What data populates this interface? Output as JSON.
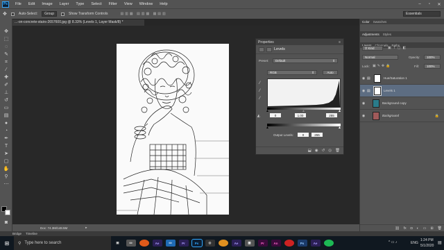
{
  "app": {
    "logo": "Ps"
  },
  "menu": [
    "File",
    "Edit",
    "Image",
    "Layer",
    "Type",
    "Select",
    "Filter",
    "View",
    "Window",
    "Help"
  ],
  "options": {
    "auto_select": "Auto-Select:",
    "group": "Group",
    "transform": "Show Transform Controls",
    "workspace": "Essentials"
  },
  "document": {
    "tab_title": "...-on-concrete-stairs-2657600.jpg @ 8.33% (Levels 1, Layer Mask/8) *",
    "status": "Doc: 74.3M/148.5M"
  },
  "properties": {
    "panel_tab": "Properties",
    "title": "Levels",
    "preset_label": "Preset:",
    "preset_value": "Default",
    "channel": "RGB",
    "auto": "Auto",
    "input": {
      "black": "0",
      "mid": "1.00",
      "white": "255"
    },
    "output_label": "Output Levels:",
    "output": {
      "black": "0",
      "white": "255"
    }
  },
  "right_panels": {
    "tabs1": [
      "Color",
      "Swatches"
    ],
    "tabs2": [
      "Adjustments",
      "Styles"
    ],
    "tabs3": [
      "Layers",
      "Channels",
      "Paths"
    ],
    "kind": "Kind",
    "blend": "Normal",
    "opacity_label": "Opacity:",
    "opacity": "100%",
    "lock_label": "Lock:",
    "fill_label": "Fill:",
    "fill": "100%",
    "layers": [
      {
        "name": "Hue/Saturation 1"
      },
      {
        "name": "Levels 1"
      },
      {
        "name": "Background copy"
      },
      {
        "name": "Background"
      }
    ]
  },
  "bottom_tabs": [
    "Bridge",
    "Timeline"
  ],
  "taskbar": {
    "search_placeholder": "Type here to search",
    "time": "1:24 PM",
    "date": "5/1/2020",
    "lang": "ENG"
  },
  "colors": {
    "accent": "#31a8ff",
    "selected_layer": "#5d6d82"
  }
}
